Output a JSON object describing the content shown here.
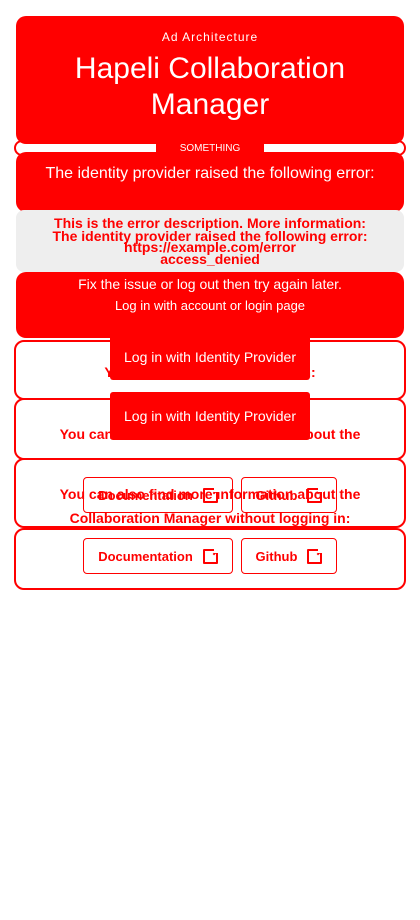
{
  "header": {
    "subtitle": "Ad Architecture",
    "title_line1": "Hapeli Collaboration",
    "title_line2": "Manager",
    "badge": "SOMETHING"
  },
  "error_overlay": {
    "lines_back": [
      "This is the error description. More information:",
      "https://example.com/error"
    ],
    "lines_front": [
      "The identity provider raised the following error:",
      "access_denied"
    ]
  },
  "faint_text": {
    "line1": "The identity provider raised the following error:",
    "line2": "Fix the issue or log out then try again later.",
    "line3": "Log in with account or login page"
  },
  "login": {
    "button1": "Log in with Identity Provider",
    "button2": "Log in with Identity Provider",
    "continue_text": "You can continue by logging in:"
  },
  "info": {
    "line1": "You can also find more information about the",
    "line2": "Collaboration Manager without logging in:"
  },
  "links": {
    "documentation": "Documentation",
    "github": "Github"
  }
}
